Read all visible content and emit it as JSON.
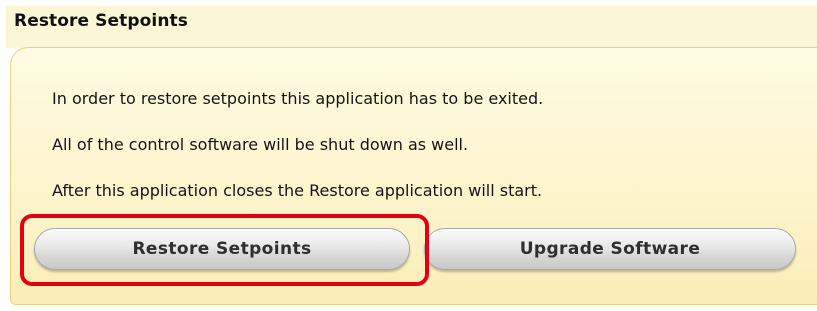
{
  "panel": {
    "title": "Restore Setpoints",
    "messages": [
      "In order to restore setpoints this application has to be exited.",
      "All of the control software will be shut down as well.",
      "After this application closes the Restore application will start."
    ],
    "buttons": {
      "restore_label": "Restore Setpoints",
      "upgrade_label": "Upgrade Software"
    }
  },
  "colors": {
    "panel_background": "#fdf4cc",
    "panel_border": "#e8d27a",
    "highlight_outline": "#e40010",
    "button_text": "#2f2f2f"
  }
}
